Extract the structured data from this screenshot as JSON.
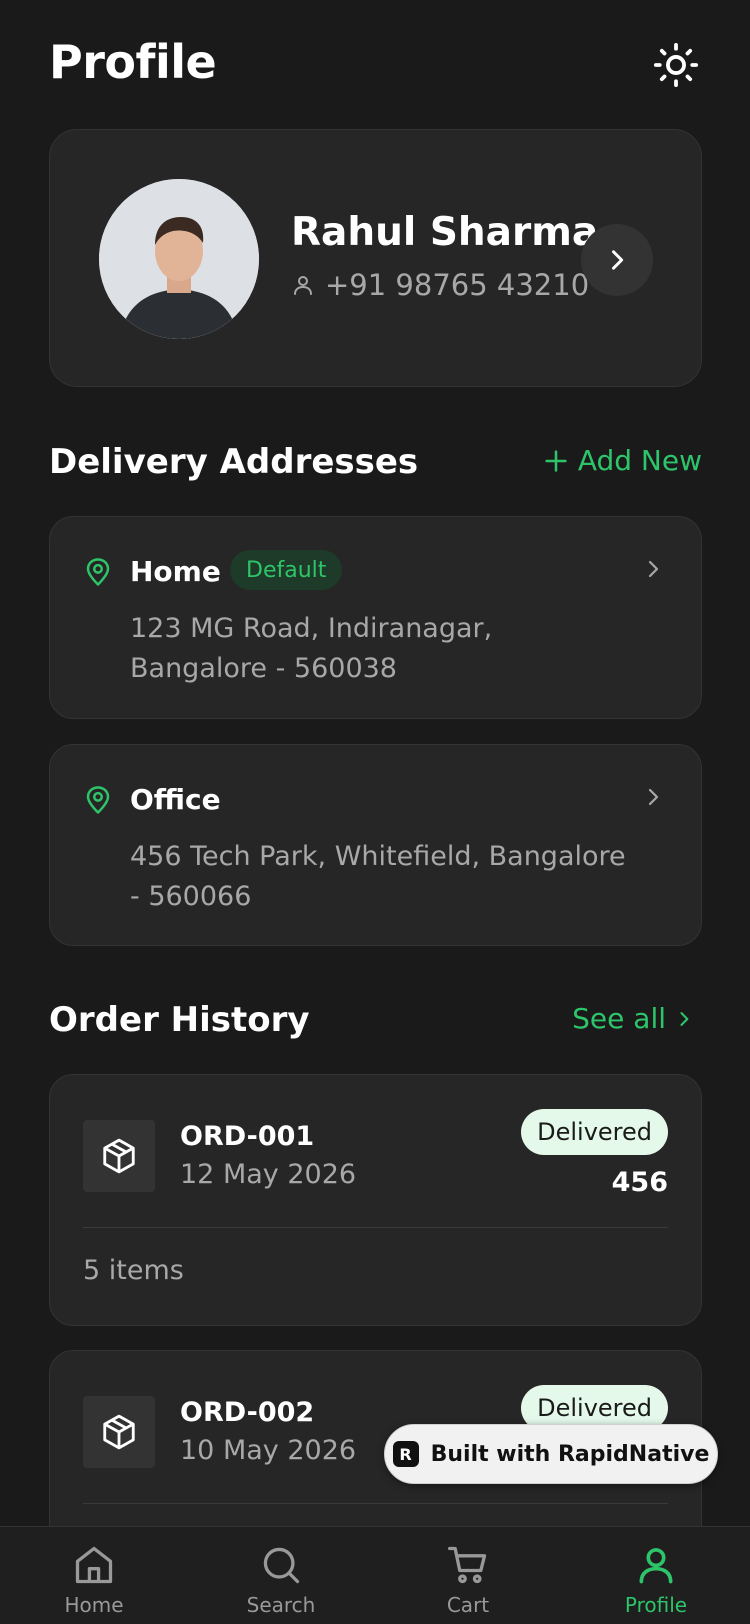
{
  "header": {
    "title": "Profile",
    "theme_icon": "sun-icon"
  },
  "profile": {
    "name": "Rahul Sharma",
    "phone": "+91 98765 43210",
    "avatar_icon": "avatar"
  },
  "addresses": {
    "title": "Delivery Addresses",
    "add_label": "Add New",
    "items": [
      {
        "label": "Home",
        "badge": "Default",
        "address": "123 MG Road, Indiranagar, Bangalore - 560038"
      },
      {
        "label": "Office",
        "badge": "",
        "address": "456 Tech Park, Whitefield, Bangalore - 560066"
      }
    ]
  },
  "orders": {
    "title": "Order History",
    "see_all": "See all",
    "items": [
      {
        "id": "ORD-001",
        "date": "12 May 2026",
        "status": "Delivered",
        "amount": "456",
        "items": "5 items"
      },
      {
        "id": "ORD-002",
        "date": "10 May 2026",
        "status": "Delivered",
        "amount": "",
        "items": ""
      }
    ]
  },
  "badge": {
    "text": "Built with RapidNative"
  },
  "tabs": [
    {
      "label": "Home",
      "icon": "home-icon"
    },
    {
      "label": "Search",
      "icon": "search-icon"
    },
    {
      "label": "Cart",
      "icon": "cart-icon"
    },
    {
      "label": "Profile",
      "icon": "profile-icon",
      "active": true
    }
  ],
  "colors": {
    "accent": "#2ec46a",
    "background": "#1a1a1a",
    "card": "#262626"
  }
}
